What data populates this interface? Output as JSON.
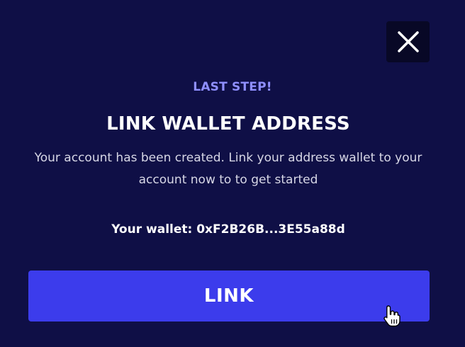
{
  "modal": {
    "step_label": "LAST STEP!",
    "title": "LINK WALLET ADDRESS",
    "description": "Your account has been created. Link your address wallet to your account now to to get started",
    "wallet_text": "Your wallet: 0xF2B26B...3E55a88d",
    "link_button_label": "LINK",
    "close_icon": "close-icon"
  },
  "colors": {
    "background": "#0f0f46",
    "accent_label": "#8f8fff",
    "button": "#3c3cec",
    "close_button_bg": "#080826"
  }
}
